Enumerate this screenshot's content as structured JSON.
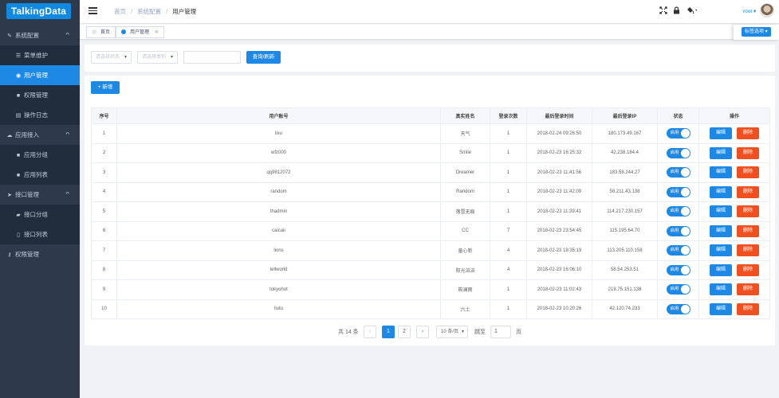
{
  "brand": {
    "logo_text": "TalkingData"
  },
  "sidebar": {
    "items": [
      {
        "label": "系统配置",
        "icon": "wrench-icon",
        "glyph": "✎",
        "type": "group",
        "arrow": "^"
      },
      {
        "label": "菜单维护",
        "icon": "menu-list-icon",
        "glyph": "☰",
        "type": "sub"
      },
      {
        "label": "用户管理",
        "icon": "user-icon",
        "glyph": "◉",
        "type": "sub",
        "active": true
      },
      {
        "label": "权限管理",
        "icon": "lock-icon",
        "glyph": "■",
        "type": "sub"
      },
      {
        "label": "操作日志",
        "icon": "log-icon",
        "glyph": "▤",
        "type": "sub"
      },
      {
        "label": "应用接入",
        "icon": "cloud-icon",
        "glyph": "☁",
        "type": "group",
        "arrow": "^"
      },
      {
        "label": "应用分组",
        "icon": "grid-icon",
        "glyph": "■",
        "type": "sub"
      },
      {
        "label": "应用列表",
        "icon": "grid-icon",
        "glyph": "■",
        "type": "sub"
      },
      {
        "label": "接口管理",
        "icon": "send-icon",
        "glyph": "➤",
        "type": "group",
        "arrow": "^"
      },
      {
        "label": "接口分组",
        "icon": "folder-icon",
        "glyph": "▰",
        "type": "sub"
      },
      {
        "label": "接口列表",
        "icon": "file-icon",
        "glyph": "▯",
        "type": "sub"
      },
      {
        "label": "权限管理",
        "icon": "key-icon",
        "glyph": "⚷",
        "type": "group"
      }
    ]
  },
  "header": {
    "breadcrumb": [
      "首页",
      "系统配置",
      "用户管理"
    ],
    "icons": [
      "fullscreen-icon",
      "lock-icon",
      "theme-icon"
    ],
    "user_name": "root"
  },
  "tags": {
    "items": [
      {
        "label": "首页",
        "active": false,
        "closable": false
      },
      {
        "label": "用户管理",
        "active": true,
        "closable": true
      }
    ],
    "options_label": "标签选项",
    "active_color": "#1e88e5"
  },
  "filters": {
    "status_placeholder": "请选择状态",
    "category_placeholder": "请选择类别",
    "search_value": "",
    "query_button": "查询/刷新"
  },
  "toolbar": {
    "add_button": "+ 新增"
  },
  "table": {
    "columns": [
      "序号",
      "用户账号",
      "真实姓名",
      "登录次数",
      "最后登录时间",
      "最后登录IP",
      "状态",
      "操作"
    ],
    "rows": [
      {
        "no": "1",
        "account": "lixu",
        "name": "天气",
        "count": "1",
        "time": "2018-02-24 09:26:50",
        "ip": "180.173.49.167",
        "status": "启用"
      },
      {
        "no": "2",
        "account": "wfz000",
        "name": "Smile",
        "count": "1",
        "time": "2018-02-23 16:25:32",
        "ip": "42.238.184.4",
        "status": "启用"
      },
      {
        "no": "3",
        "account": "qq9812072",
        "name": "Dreamer",
        "count": "1",
        "time": "2018-02-23 11:41:56",
        "ip": "183.58.244.27",
        "status": "启用"
      },
      {
        "no": "4",
        "account": "random",
        "name": "Random",
        "count": "1",
        "time": "2018-02-23 11:42:09",
        "ip": "58.211.43.138",
        "status": "启用"
      },
      {
        "no": "5",
        "account": "thadmin",
        "name": "落雪无痕",
        "count": "1",
        "time": "2018-02-23 11:39:41",
        "ip": "114.217.230.157",
        "status": "启用"
      },
      {
        "no": "6",
        "account": "caicaii",
        "name": "CC",
        "count": "7",
        "time": "2018-02-23 23:54:45",
        "ip": "115.195.64.70",
        "status": "启用"
      },
      {
        "no": "7",
        "account": "lions",
        "name": "童心新",
        "count": "4",
        "time": "2018-02-23 19:35:19",
        "ip": "113.205.110.158",
        "status": "启用"
      },
      {
        "no": "8",
        "account": "tellworld",
        "name": "阳光滔滔",
        "count": "4",
        "time": "2018-02-23 16:06:10",
        "ip": "58.54.253.51",
        "status": "启用"
      },
      {
        "no": "9",
        "account": "tokyohot",
        "name": "筱澜雨",
        "count": "1",
        "time": "2018-02-23 11:02:43",
        "ip": "218.75.151.138",
        "status": "启用"
      },
      {
        "no": "10",
        "account": "liutu",
        "name": "六土",
        "count": "1",
        "time": "2018-02-23 10:20:26",
        "ip": "42.120.74.233",
        "status": "启用"
      }
    ],
    "edit_label": "编辑",
    "delete_label": "删除"
  },
  "pagination": {
    "total_text": "共 14 条",
    "prev": "‹",
    "pages": [
      "1",
      "2"
    ],
    "current": "1",
    "next": "›",
    "page_size": "10 条/页",
    "jump_label": "跳至",
    "jump_value": "1",
    "page_unit": "页"
  },
  "colors": {
    "primary": "#1e88e5",
    "danger": "#f0501f",
    "sidebar_bg": "#2d3a4b",
    "sidebar_sub_bg": "#1f2d3d"
  }
}
